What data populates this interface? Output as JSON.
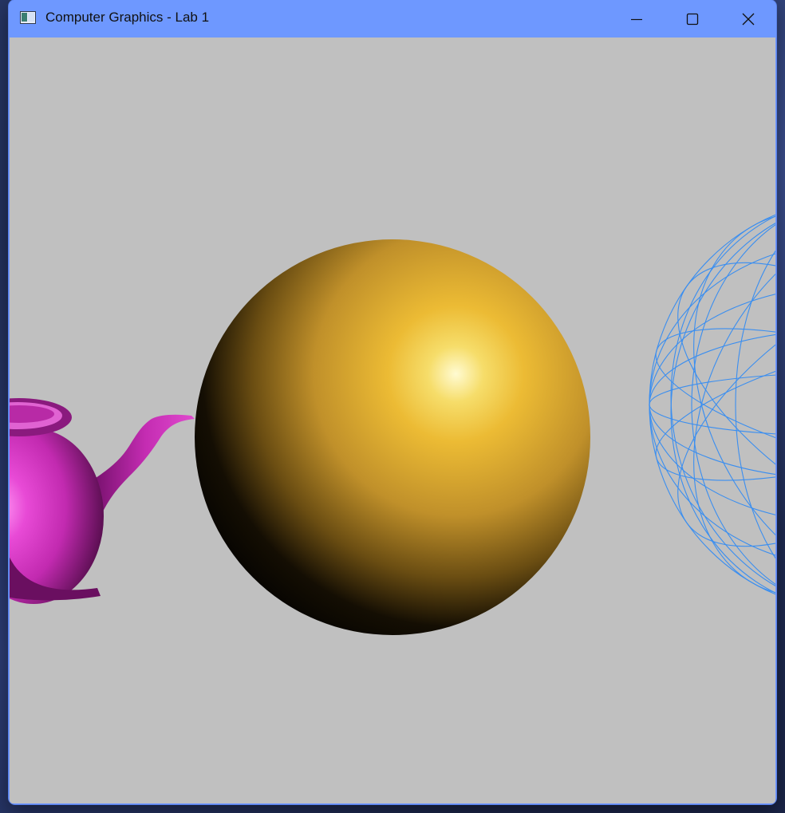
{
  "window": {
    "title": "Computer Graphics - Lab 1",
    "app_icon": "window-app-icon",
    "controls": {
      "minimize_icon": "minimize-icon",
      "maximize_icon": "maximize-icon",
      "close_icon": "close-icon"
    }
  },
  "scene": {
    "background_color": "#c0c0c0",
    "objects": [
      {
        "name": "teapot",
        "style": "solid-shaded",
        "color": "#d92fc4"
      },
      {
        "name": "sphere",
        "style": "solid-shaded-specular",
        "color": "#e8b030"
      },
      {
        "name": "wire-sphere",
        "style": "wireframe",
        "color": "#3a8ef0"
      }
    ]
  },
  "colors": {
    "titlebar": "#6e98ff",
    "desktop": "#1f2a4d"
  }
}
